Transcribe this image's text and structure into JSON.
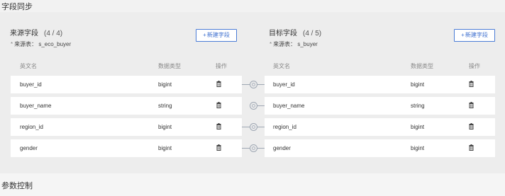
{
  "section_titles": {
    "field_sync": "字段同步",
    "param_control": "参数控制"
  },
  "source": {
    "title": "来源字段",
    "count": "(4 / 4)",
    "table_label": "来源表：",
    "table_name": "s_eco_buyer",
    "add_button": "新建字段",
    "columns": {
      "name": "英文名",
      "type": "数据类型",
      "action": "操作"
    },
    "rows": [
      {
        "name": "buyer_id",
        "type": "bigint"
      },
      {
        "name": "buyer_name",
        "type": "string"
      },
      {
        "name": "region_id",
        "type": "bigint"
      },
      {
        "name": "gender",
        "type": "bigint"
      }
    ]
  },
  "target": {
    "title": "目标字段",
    "count": "(4 / 5)",
    "table_label": "来源表：",
    "table_name": "s_buyer",
    "add_button": "新建字段",
    "columns": {
      "name": "英文名",
      "type": "数据类型",
      "action": "操作"
    },
    "rows": [
      {
        "name": "buyer_id",
        "type": "bigint"
      },
      {
        "name": "buyer_name",
        "type": "string"
      },
      {
        "name": "region_id",
        "type": "bigint"
      },
      {
        "name": "gender",
        "type": "bigint"
      }
    ]
  },
  "icons": {
    "delete": "trash-icon",
    "link": "link-connector-icon",
    "add": "plus-icon"
  },
  "colors": {
    "accent": "#3d6fcf",
    "panel_bg": "#ededed",
    "row_bg": "#ffffff",
    "connector": "#9ea7b3"
  }
}
